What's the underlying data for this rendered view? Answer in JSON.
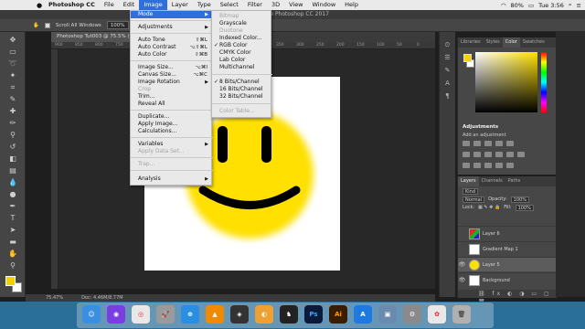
{
  "menubar": {
    "app": "Photoshop CC",
    "items": [
      "File",
      "Edit",
      "Image",
      "Layer",
      "Type",
      "Select",
      "Filter",
      "3D",
      "View",
      "Window",
      "Help"
    ],
    "active": "Image",
    "battery": "80%",
    "clock": "Tue 3:56"
  },
  "window_title": "Adobe Photoshop CC 2017",
  "options": {
    "scroll_all": "Scroll All Windows",
    "zoom": "100%"
  },
  "document": {
    "tab": "Photoshop Tut003 @ 75.5% (Layer 5, RGB/8)",
    "zoom_status": "75.47%",
    "doc_size": "Doc: 4.46M/8.77M"
  },
  "ruler_ticks": [
    "900",
    "850",
    "800",
    "750",
    "700",
    "650",
    "600",
    "550",
    "500",
    "450",
    "400",
    "350",
    "300",
    "250",
    "200",
    "150",
    "100",
    "50",
    "0"
  ],
  "image_menu": {
    "mode": "Mode",
    "adjustments": "Adjustments",
    "auto_tone": "Auto Tone",
    "auto_tone_sc": "⇧⌘L",
    "auto_contrast": "Auto Contrast",
    "auto_contrast_sc": "⌥⇧⌘L",
    "auto_color": "Auto Color",
    "auto_color_sc": "⇧⌘B",
    "image_size": "Image Size...",
    "image_size_sc": "⌥⌘I",
    "canvas_size": "Canvas Size...",
    "canvas_size_sc": "⌥⌘C",
    "image_rotation": "Image Rotation",
    "crop": "Crop",
    "trim": "Trim...",
    "reveal_all": "Reveal All",
    "duplicate": "Duplicate...",
    "apply_image": "Apply Image...",
    "calculations": "Calculations...",
    "variables": "Variables",
    "apply_data_set": "Apply Data Set...",
    "trap": "Trap...",
    "analysis": "Analysis"
  },
  "mode_menu": {
    "bitmap": "Bitmap",
    "grayscale": "Grayscale",
    "duotone": "Duotone",
    "indexed": "Indexed Color...",
    "rgb": "RGB Color",
    "cmyk": "CMYK Color",
    "lab": "Lab Color",
    "multichannel": "Multichannel",
    "bits8": "8 Bits/Channel",
    "bits16": "16 Bits/Channel",
    "bits32": "32 Bits/Channel",
    "color_table": "Color Table...",
    "check": "✓"
  },
  "color_panel": {
    "tabs": [
      "Libraries",
      "Styles",
      "Color",
      "Swatches"
    ],
    "active": "Color",
    "foreground": "#f5d300"
  },
  "adjustments_panel": {
    "title": "Adjustments",
    "add_label": "Add an adjustment"
  },
  "layers_panel": {
    "tabs": [
      "Layers",
      "Channels",
      "Paths"
    ],
    "kind": "Kind",
    "blend": "Normal",
    "opacity_label": "Opacity:",
    "opacity": "100%",
    "lock_label": "Lock:",
    "fill_label": "Fill:",
    "fill": "100%",
    "layers": [
      {
        "name": "Layer 6"
      },
      {
        "name": "Gradient Map 1"
      },
      {
        "name": "Layer 5"
      },
      {
        "name": "Background"
      }
    ]
  },
  "dock": {
    "icons": [
      "Finder",
      "Siri",
      "Chrome",
      "Launchpad",
      "Safari",
      "VLC",
      "Unity",
      "Blender",
      "Cat",
      "Ps",
      "Ai",
      "App Store",
      "Preview",
      "Settings",
      "Photos",
      "Trash"
    ]
  }
}
